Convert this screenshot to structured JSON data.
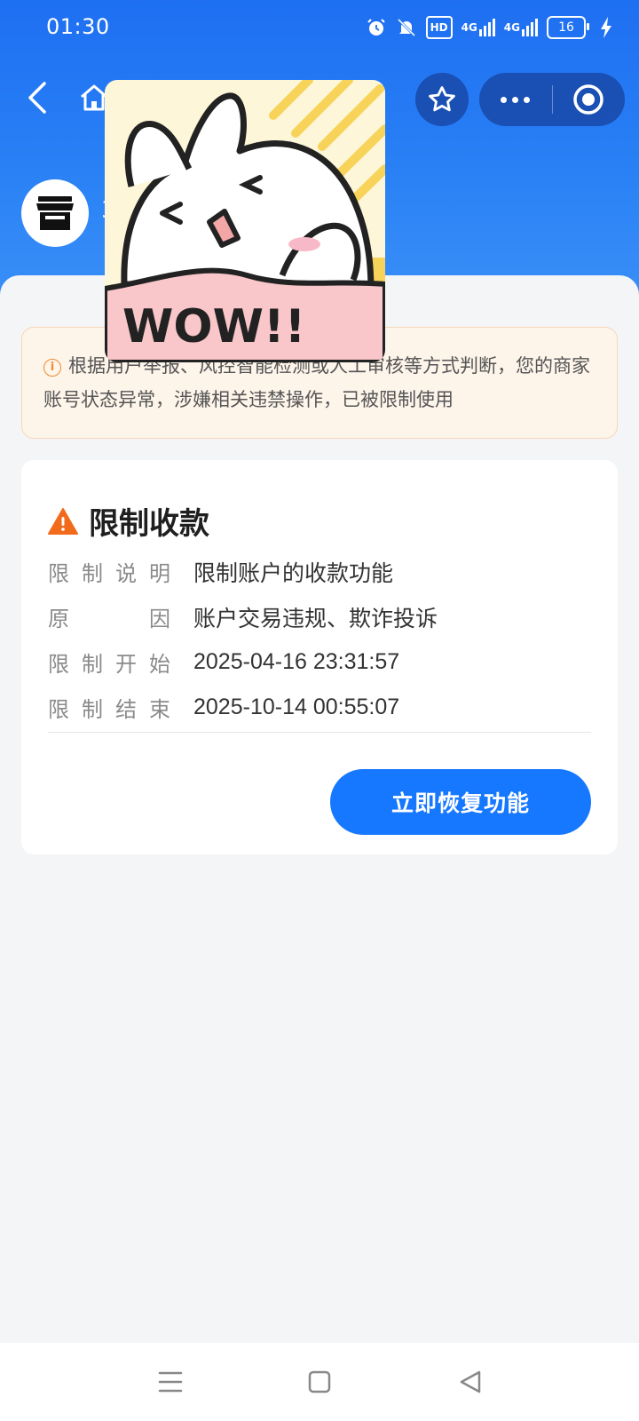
{
  "status_bar": {
    "time": "01:30",
    "hd_label": "HD",
    "net1": "4G",
    "net2": "4G",
    "battery": "16",
    "icons": [
      "alarm-icon",
      "mute-bell-icon",
      "hd-icon",
      "signal-icon",
      "signal-icon",
      "battery-icon",
      "charging-icon"
    ]
  },
  "nav": {
    "icons": [
      "back-arrow-icon",
      "home-icon",
      "star-icon",
      "more-dots-icon",
      "target-icon"
    ]
  },
  "merchant": {
    "avatar_icon": "store-icon",
    "name_fragment": "3"
  },
  "notice": {
    "icon": "info-icon",
    "text": "根据用户举报、风控智能检测或人工审核等方式判断，您的商家账号状态异常，涉嫌相关违禁操作，已被限制使用"
  },
  "restriction": {
    "icon": "warning-icon",
    "title": "限制收款",
    "rows": [
      {
        "label": [
          "限",
          "制",
          "说",
          "明"
        ],
        "value": "限制账户的收款功能"
      },
      {
        "label": [
          "原",
          "因"
        ],
        "value": "账户交易违规、欺诈投诉"
      },
      {
        "label": [
          "限",
          "制",
          "开",
          "始"
        ],
        "value": "2025-04-16 23:31:57"
      },
      {
        "label": [
          "限",
          "制",
          "结",
          "束"
        ],
        "value": "2025-10-14 00:55:07"
      }
    ],
    "button_label": "立即恢复功能"
  },
  "sticker": {
    "text": "WOW!!"
  },
  "bottom_nav": {
    "icons": [
      "menu-icon",
      "home-square-icon",
      "back-triangle-icon"
    ]
  },
  "colors": {
    "header_blue": "#1e6ff2",
    "button_blue": "#1677ff",
    "warning_orange": "#f26b1d",
    "notice_bg": "#fdf4ea"
  }
}
